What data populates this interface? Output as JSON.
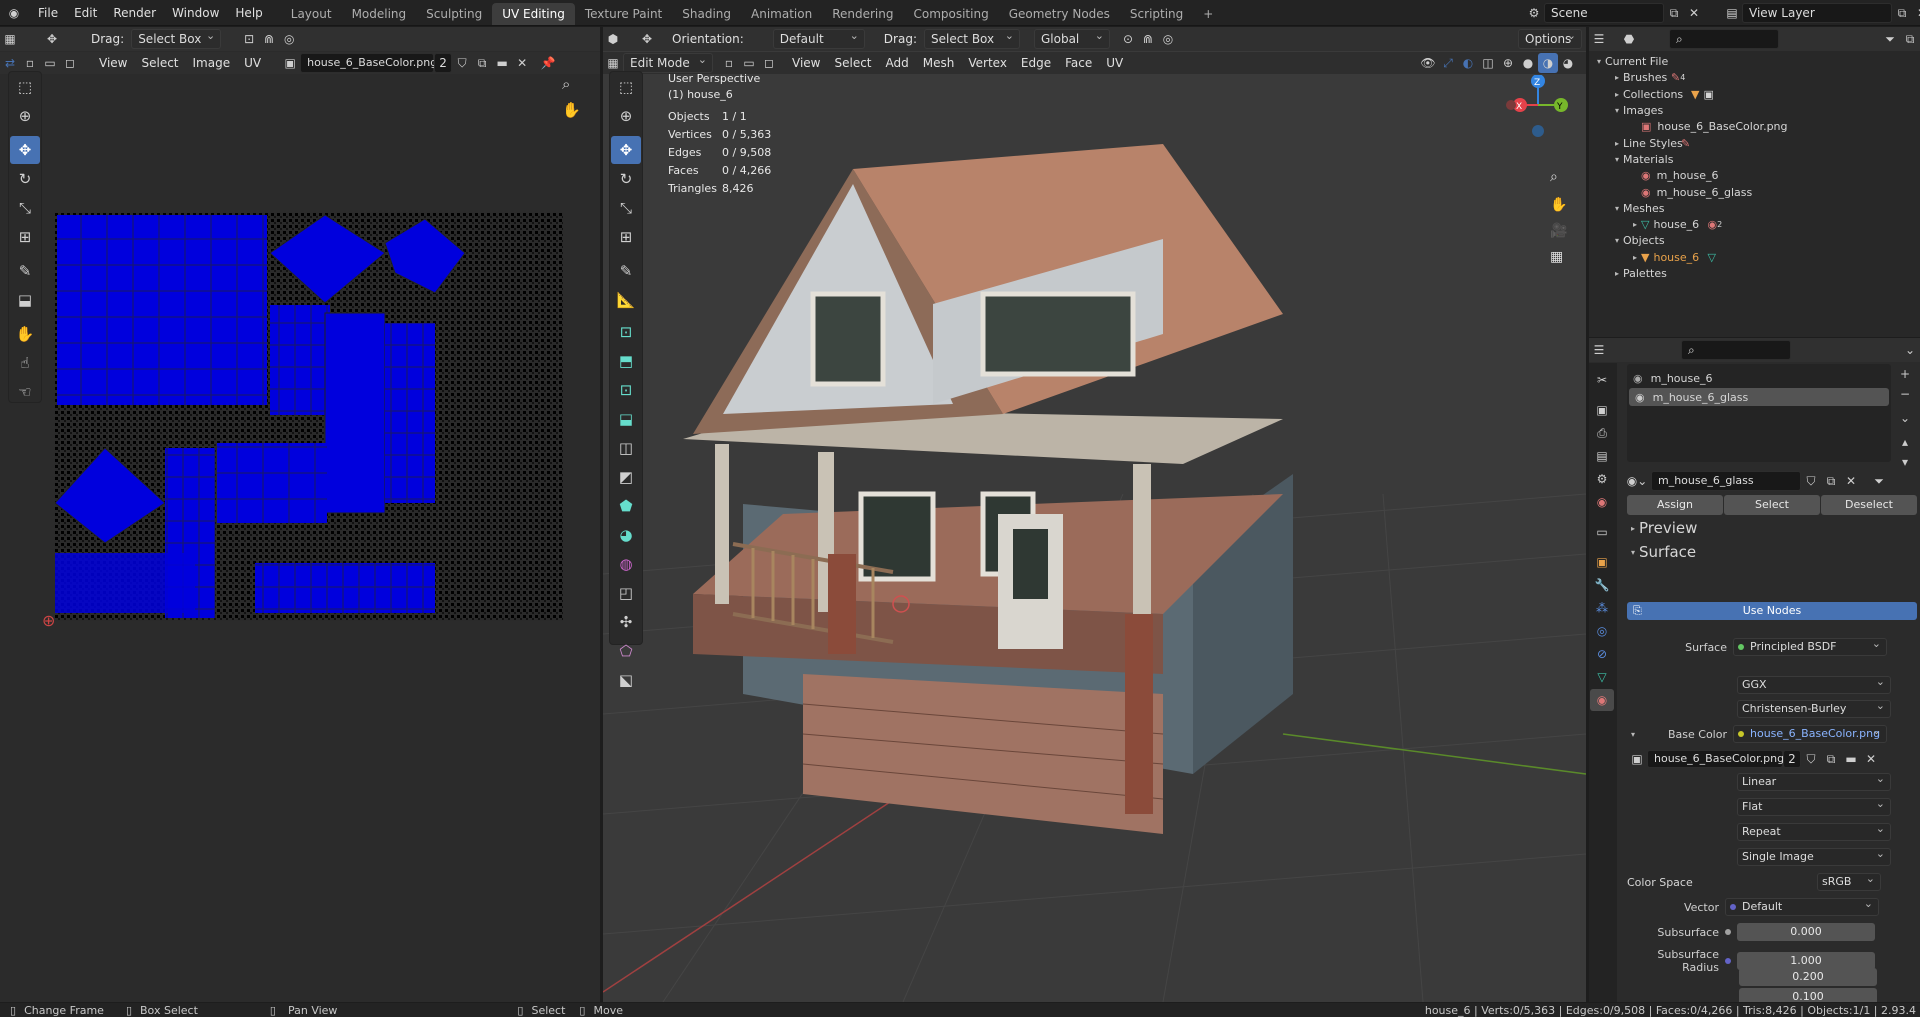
{
  "app": {
    "menu": [
      "File",
      "Edit",
      "Render",
      "Window",
      "Help"
    ],
    "workspaces": [
      "Layout",
      "Modeling",
      "Sculpting",
      "UV Editing",
      "Texture Paint",
      "Shading",
      "Animation",
      "Rendering",
      "Compositing",
      "Geometry Nodes",
      "Scripting"
    ],
    "active_workspace": "UV Editing",
    "scene": "Scene",
    "view_layer": "View Layer"
  },
  "uv_editor": {
    "drag_label": "Drag:",
    "drag_value": "Select Box",
    "menus": [
      "View",
      "Select",
      "Image",
      "UV"
    ],
    "image_name": "house_6_BaseColor.png",
    "users": "2"
  },
  "viewport": {
    "drag_label": "Drag:",
    "drag_value": "Select Box",
    "orientation_label": "Orientation:",
    "orientation_value": "Default",
    "transform_value": "Global",
    "options_label": "Options",
    "mode": "Edit Mode",
    "menus": [
      "View",
      "Select",
      "Add",
      "Mesh",
      "Vertex",
      "Edge",
      "Face",
      "UV"
    ],
    "perspective": "User Perspective",
    "object_label": "(1) house_6",
    "stats": [
      {
        "k": "Objects",
        "v": "1 / 1"
      },
      {
        "k": "Vertices",
        "v": "0 / 5,363"
      },
      {
        "k": "Edges",
        "v": "0 / 9,508"
      },
      {
        "k": "Faces",
        "v": "0 / 4,266"
      },
      {
        "k": "Triangles",
        "v": "8,426"
      }
    ],
    "gizmo": {
      "z": "Z",
      "y": "Y",
      "x": "X"
    }
  },
  "outliner": {
    "root": "Current File",
    "brushes_count": "4",
    "meshes_count": "2",
    "items": [
      "Brushes",
      "Collections",
      "Images",
      "house_6_BaseColor.png",
      "Line Styles",
      "Materials",
      "m_house_6",
      "m_house_6_glass",
      "Meshes",
      "house_6",
      "Objects",
      "house_6",
      "Palettes"
    ]
  },
  "properties": {
    "slots": [
      "m_house_6",
      "m_house_6_glass"
    ],
    "material": "m_house_6_glass",
    "assign": "Assign",
    "select": "Select",
    "deselect": "Deselect",
    "preview": "Preview",
    "surface_panel": "Surface",
    "use_nodes": "Use Nodes",
    "surface_label": "Surface",
    "surface_value": "Principled BSDF",
    "distribution": "GGX",
    "subsurface_method": "Christensen-Burley",
    "base_color_label": "Base Color",
    "base_color_value": "house_6_BaseColor.png",
    "image_name": "house_6_BaseColor.png",
    "image_users": "2",
    "interp": "Linear",
    "projection": "Flat",
    "extension": "Repeat",
    "source": "Single Image",
    "color_space_label": "Color Space",
    "color_space_value": "sRGB",
    "vector_label": "Vector",
    "vector_value": "Default",
    "subsurface_label": "Subsurface",
    "subsurface_value": "0.000",
    "ss_radius_label": "Subsurface Radius",
    "ss_radius": [
      "1.000",
      "0.200",
      "0.100"
    ]
  },
  "status": {
    "change_frame": "Change Frame",
    "box_select": "Box Select",
    "pan_view": "Pan View",
    "select": "Select",
    "move": "Move",
    "stats": "house_6 | Verts:0/5,363 | Edges:0/9,508 | Faces:0/4,266 | Tris:8,426 | Objects:1/1 | 2.93.4"
  },
  "colors": {
    "accent": "#4772b3",
    "uv_blue": "#0000dd",
    "x_axis": "#e5424a",
    "y_axis": "#77b72b",
    "z_axis": "#3385e2"
  }
}
